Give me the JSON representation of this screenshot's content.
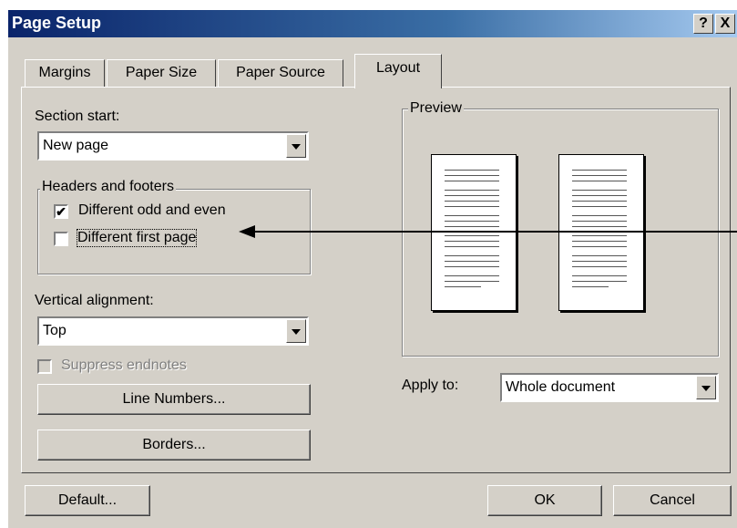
{
  "dialog": {
    "title": "Page Setup",
    "help_label": "?",
    "close_label": "X"
  },
  "tabs": [
    {
      "label": "Margins"
    },
    {
      "label": "Paper Size"
    },
    {
      "label": "Paper Source"
    },
    {
      "label": "Layout"
    }
  ],
  "section_start": {
    "label": "Section start:",
    "value": "New page"
  },
  "headers_footers": {
    "legend": "Headers and footers",
    "odd_even_label": "Different odd and even",
    "odd_even_checked": true,
    "first_page_label": "Different first page",
    "first_page_checked": false,
    "check_mark": "✔"
  },
  "vertical_alignment": {
    "label": "Vertical alignment:",
    "value": "Top"
  },
  "suppress_endnotes": {
    "label": "Suppress endnotes",
    "checked": false
  },
  "buttons": {
    "line_numbers": "Line Numbers...",
    "borders": "Borders...",
    "default": "Default...",
    "ok": "OK",
    "cancel": "Cancel"
  },
  "preview": {
    "legend": "Preview"
  },
  "apply_to": {
    "label": "Apply to:",
    "value": "Whole document"
  }
}
